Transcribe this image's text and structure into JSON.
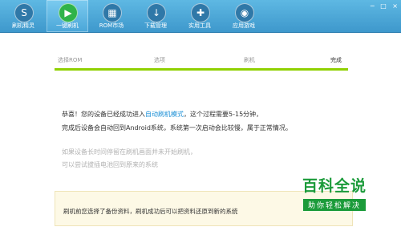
{
  "toolbar": {
    "items": [
      {
        "label": "刷机精灵",
        "icon": "logo-icon"
      },
      {
        "label": "一键刷机",
        "icon": "play-icon"
      },
      {
        "label": "ROM市场",
        "icon": "rom-market-icon"
      },
      {
        "label": "下载管理",
        "icon": "download-icon"
      },
      {
        "label": "实用工具",
        "icon": "tools-icon"
      },
      {
        "label": "应用游戏",
        "icon": "apps-icon"
      }
    ],
    "win_buttons": [
      "─",
      "□",
      "×"
    ]
  },
  "steps": [
    {
      "label": "选择ROM"
    },
    {
      "label": "选项"
    },
    {
      "label": "刷机"
    },
    {
      "label": "完成"
    }
  ],
  "message": {
    "line1_a": "恭喜！您的设备已经成功进入",
    "line1_link": "自动刷机模式",
    "line1_b": "，这个过程需要5-15分钟，",
    "line2": "完成后设备会自动回到Android系统，系统第一次启动会比较慢，属于正常情况。"
  },
  "hint": {
    "line1": "如果设备长时间停留在刷机画面并未开始刷机，",
    "line2": "可以尝试拔插电池回到原来的系统"
  },
  "notice": {
    "text": "刷机前您选择了备份资料，刷机成功后可以把资料还原到新的系统"
  },
  "watermark": {
    "title": "百科全说",
    "subtitle": "助你轻松解决"
  },
  "colors": {
    "toolbar": "#4aa6d8",
    "progress": "#8fd000",
    "link": "#1a8fd6",
    "notice_bg": "#fdf9e6"
  }
}
